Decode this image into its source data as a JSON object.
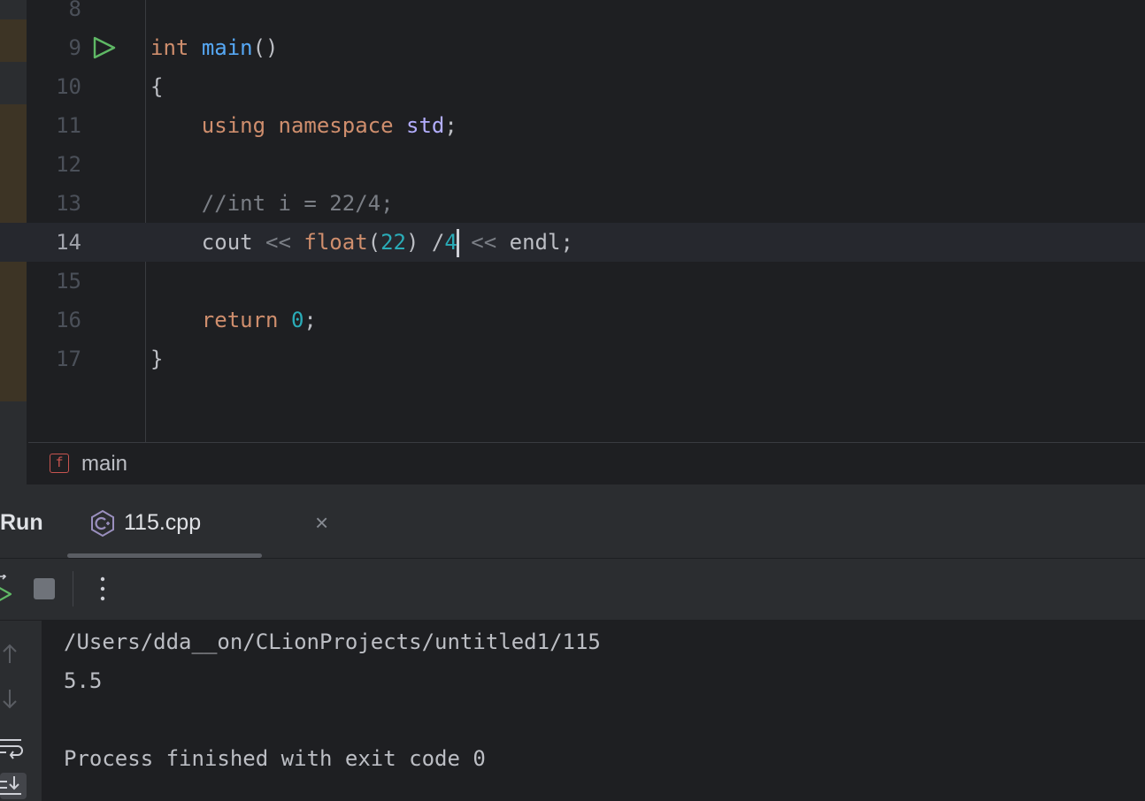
{
  "colors": {
    "keyword": "#cf8e6d",
    "function": "#56a8f5",
    "namespace": "#b3aeff",
    "number": "#2aacb8",
    "comment": "#7a7e85",
    "text": "#bcbec4",
    "run_green": "#5fb865"
  },
  "editor": {
    "lines": [
      {
        "number": "8",
        "tokens": []
      },
      {
        "number": "9",
        "run_icon": "run-icon",
        "tokens": [
          {
            "text": "int",
            "kind": "keyword"
          },
          {
            "text": " ",
            "kind": "text"
          },
          {
            "text": "main",
            "kind": "function"
          },
          {
            "text": "()",
            "kind": "text"
          }
        ]
      },
      {
        "number": "10",
        "tokens": [
          {
            "text": "{",
            "kind": "text"
          }
        ]
      },
      {
        "number": "11",
        "tokens": [
          {
            "text": "    ",
            "kind": "text"
          },
          {
            "text": "using",
            "kind": "keyword"
          },
          {
            "text": " ",
            "kind": "text"
          },
          {
            "text": "namespace",
            "kind": "keyword"
          },
          {
            "text": " ",
            "kind": "text"
          },
          {
            "text": "std",
            "kind": "namespace"
          },
          {
            "text": ";",
            "kind": "text"
          }
        ]
      },
      {
        "number": "12",
        "tokens": []
      },
      {
        "number": "13",
        "tokens": [
          {
            "text": "    ",
            "kind": "text"
          },
          {
            "text": "//int i = 22/4;",
            "kind": "comment"
          }
        ]
      },
      {
        "number": "14",
        "current": true,
        "tokens": [
          {
            "text": "    ",
            "kind": "text"
          },
          {
            "text": "cout",
            "kind": "text"
          },
          {
            "text": " ",
            "kind": "text"
          },
          {
            "text": "<<",
            "kind": "comment"
          },
          {
            "text": " ",
            "kind": "text"
          },
          {
            "text": "float",
            "kind": "keyword"
          },
          {
            "text": "(",
            "kind": "text"
          },
          {
            "text": "22",
            "kind": "number"
          },
          {
            "text": ") /",
            "kind": "text"
          },
          {
            "text": "4",
            "kind": "number",
            "caret_after": true
          },
          {
            "text": " ",
            "kind": "text"
          },
          {
            "text": "<<",
            "kind": "comment"
          },
          {
            "text": " ",
            "kind": "text"
          },
          {
            "text": "endl",
            "kind": "text"
          },
          {
            "text": ";",
            "kind": "text"
          }
        ]
      },
      {
        "number": "15",
        "tokens": []
      },
      {
        "number": "16",
        "tokens": [
          {
            "text": "    ",
            "kind": "text"
          },
          {
            "text": "return",
            "kind": "keyword"
          },
          {
            "text": " ",
            "kind": "text"
          },
          {
            "text": "0",
            "kind": "number"
          },
          {
            "text": ";",
            "kind": "text"
          }
        ]
      },
      {
        "number": "17",
        "tokens": [
          {
            "text": "}",
            "kind": "text"
          }
        ]
      }
    ]
  },
  "breadcrumb": {
    "icon": "function-icon",
    "icon_letter": "f",
    "label": "main"
  },
  "run_window": {
    "title": "Run",
    "tab": {
      "icon": "cpp-file-icon",
      "label": "115.cpp",
      "close": "×"
    },
    "toolbar": {
      "rerun_icon": "rerun-icon",
      "stop_icon": "stop-icon",
      "more_icon": "more-options-icon"
    },
    "side_icons": [
      "scroll-up-icon",
      "scroll-down-icon",
      "soft-wrap-icon",
      "scroll-to-end-icon"
    ],
    "console": [
      "/Users/dda__on/CLionProjects/untitled1/115",
      "5.5",
      "",
      "Process finished with exit code 0"
    ]
  }
}
